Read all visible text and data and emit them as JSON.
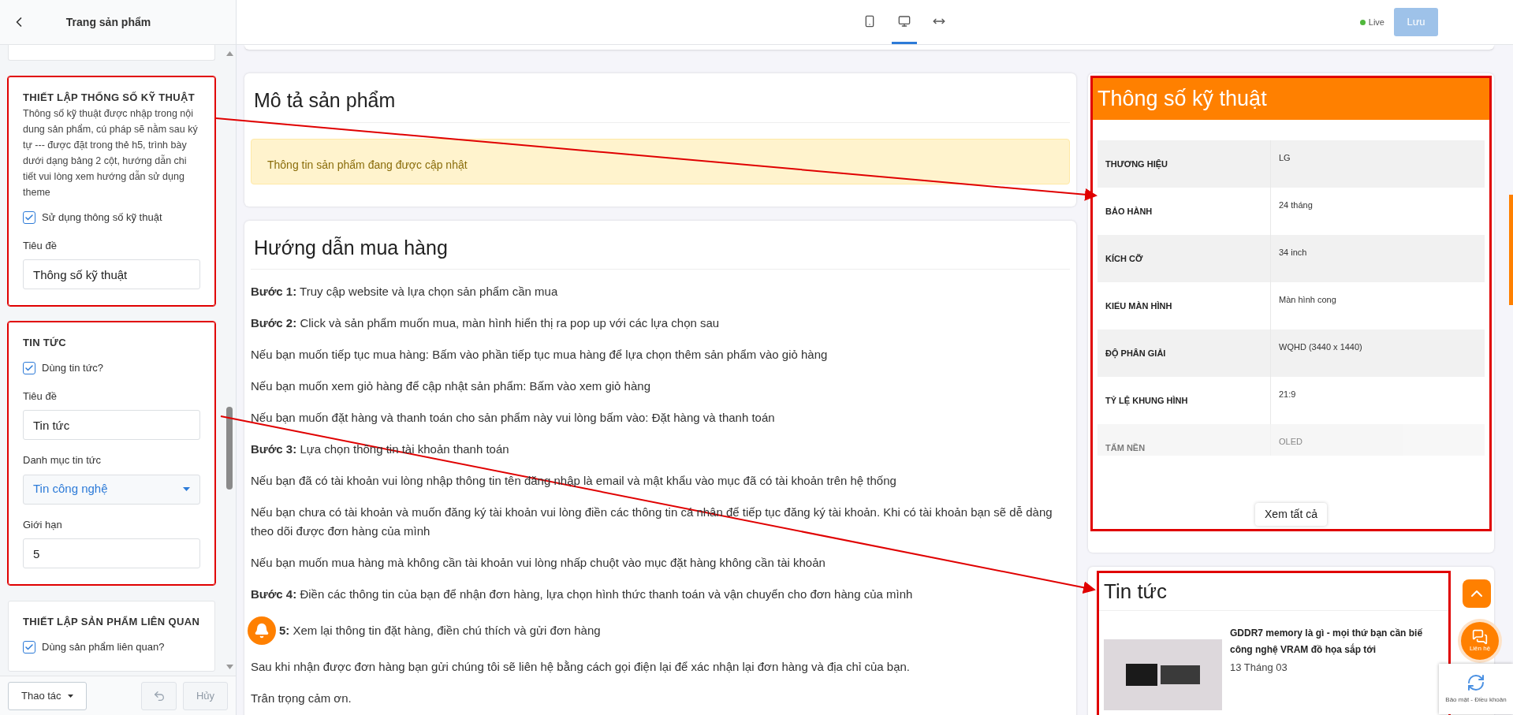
{
  "sidebar": {
    "title": "Trang sản phẩm",
    "sections": [
      {
        "heading": "THIẾT LẬP THỐNG SỐ KỸ THUẬT",
        "description": "Thông số kỹ thuật được nhập trong nội dung sản phẩm, cú pháp sẽ nằm sau ký tự --- được đặt trong thẻ h5, trình bày dưới dạng bảng 2 cột, hướng dẫn chi tiết vui lòng xem hướng dẫn sử dụng theme",
        "highlighted": true,
        "fields": [
          {
            "kind": "checkbox",
            "label": "Sử dụng thông số kỹ thuật",
            "checked": true
          },
          {
            "kind": "text",
            "label": "Tiêu đề",
            "value": "Thông số kỹ thuật"
          }
        ]
      },
      {
        "heading": "TIN TỨC",
        "highlighted": true,
        "fields": [
          {
            "kind": "checkbox",
            "label": "Dùng tin tức?",
            "checked": true
          },
          {
            "kind": "text",
            "label": "Tiêu đề",
            "value": "Tin tức"
          },
          {
            "kind": "select",
            "label": "Danh mục tin tức",
            "value": "Tin công nghệ"
          },
          {
            "kind": "text",
            "label": "Giới hạn",
            "value": "5"
          }
        ]
      },
      {
        "heading": "THIẾT LẬP SẢN PHẨM LIÊN QUAN",
        "highlighted": false,
        "fields": [
          {
            "kind": "checkbox",
            "label": "Dùng sản phẩm liên quan?",
            "checked": true
          }
        ]
      }
    ],
    "footer": {
      "actions_button": "Thao tác",
      "cancel_button": {
        "label": "Hủy",
        "disabled": true
      }
    }
  },
  "toolbar": {
    "devices": [
      {
        "kind": "mobile",
        "selected": false
      },
      {
        "kind": "desktop",
        "selected": true
      },
      {
        "kind": "fullwidth",
        "selected": false
      }
    ],
    "status": "Live",
    "save_button": {
      "label": "Lưu",
      "disabled": true
    }
  },
  "preview": {
    "description": {
      "title": "Mô tả sản phẩm",
      "notice": "Thông tin sản phẩm đang được cập nhật"
    },
    "guide": {
      "title": "Hướng dẫn mua hàng",
      "paragraphs": [
        "**Bước 1:** Truy cập website và lựa chọn sản phẩm cần mua",
        "**Bước 2:** Click và sản phẩm muốn mua, màn hình hiển thị ra pop up với các lựa chọn sau",
        "Nếu bạn muốn tiếp tục mua hàng: Bấm vào phần tiếp tục mua hàng để lựa chọn thêm sản phẩm vào giỏ hàng",
        "Nếu bạn muốn xem giỏ hàng để cập nhật sản phẩm: Bấm vào xem giỏ hàng",
        "Nếu bạn muốn đặt hàng và thanh toán cho sản phẩm này vui lòng bấm vào: Đặt hàng và thanh toán",
        "**Bước 3:** Lựa chọn thông tin tài khoản thanh toán",
        "Nếu bạn đã có tài khoản vui lòng nhập thông tin tên đăng nhập là email và mật khẩu vào mục đã có tài khoản trên hệ thống",
        "Nếu bạn chưa có tài khoản và muốn đăng ký tài khoản vui lòng điền các thông tin cá nhân để tiếp tục đăng ký tài khoản. Khi có tài khoản bạn sẽ dễ dàng theo dõi được đơn hàng của mình",
        "Nếu bạn muốn mua hàng mà không cần tài khoản vui lòng nhấp chuột vào mục đặt hàng không cần tài khoản",
        "**Bước 4:** Điền các thông tin của bạn để nhận đơn hàng, lựa chọn hình thức thanh toán và vận chuyển cho đơn hàng của mình",
        "**5:** Xem lại thông tin đặt hàng, điền chú thích và gửi đơn hàng",
        "Sau khi nhận được đơn hàng bạn gửi chúng tôi sẽ liên hệ bằng cách gọi điện lại để xác nhận lại đơn hàng và địa chỉ của bạn.",
        "Trân trọng cảm ơn."
      ]
    },
    "specs": {
      "title": "Thông số kỹ thuật",
      "highlighted": true,
      "rows": [
        {
          "name": "THƯƠNG HIỆU",
          "value": "LG",
          "faded": false
        },
        {
          "name": "BẢO HÀNH",
          "value": "24 tháng",
          "faded": false
        },
        {
          "name": "KÍCH CỠ",
          "value": "34 inch",
          "faded": false
        },
        {
          "name": "KIỂU MÀN HÌNH",
          "value": "Màn hình cong",
          "faded": false
        },
        {
          "name": "ĐỘ PHÂN GIẢI",
          "value": "WQHD (3440 x 1440)",
          "faded": false
        },
        {
          "name": "TỶ LỆ KHUNG HÌNH",
          "value": "21:9",
          "faded": false
        },
        {
          "name": "TẤM NỀN",
          "value": "OLED",
          "faded": true
        }
      ],
      "view_all": "Xem tất cả"
    },
    "news": {
      "title": "Tin tức",
      "highlighted": true,
      "items": [
        {
          "title": "GDDR7 memory là gì - mọi thứ bạn cần biế công nghệ VRAM đồ họa sắp tới",
          "date": "13 Tháng 03"
        }
      ]
    },
    "floating": {
      "contact_label": "Liên hệ",
      "recaptcha_text": "Bảo mật - Điều khoản"
    }
  }
}
